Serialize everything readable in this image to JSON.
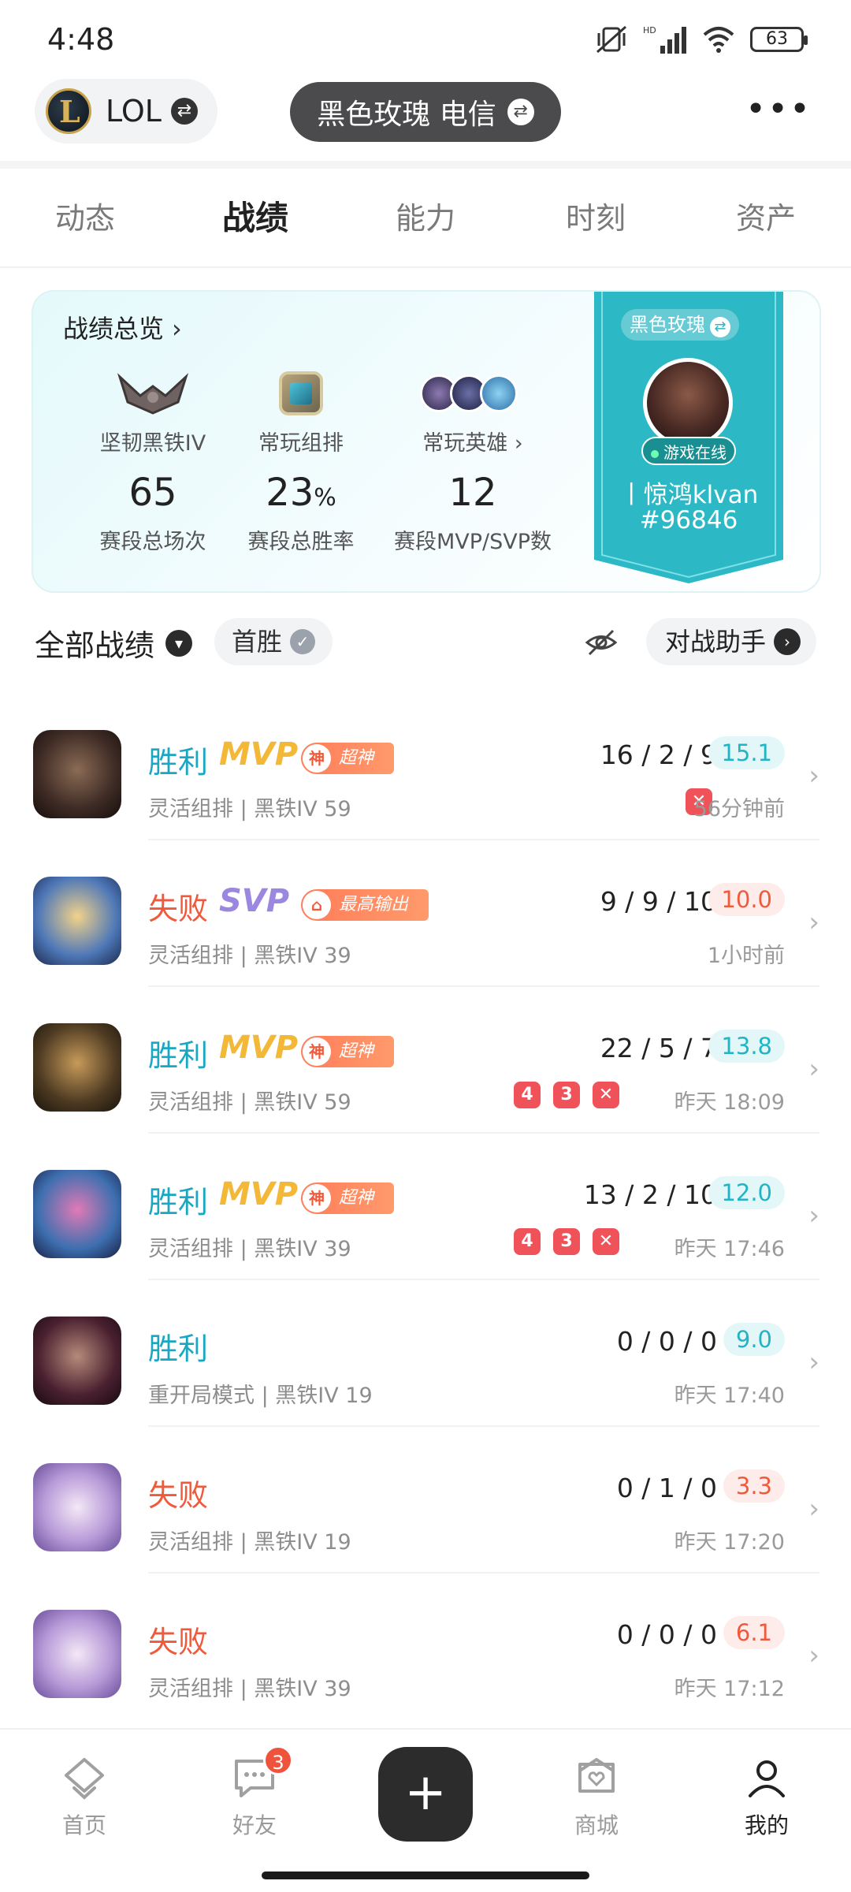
{
  "status_bar": {
    "time": "4:48",
    "battery": "63",
    "signal_label": "HD"
  },
  "header": {
    "game_name": "LOL",
    "game_logo_letter": "L",
    "account_label": "黑色玫瑰 电信",
    "swap_glyph": "⇄",
    "more_glyph": "•••"
  },
  "tabs": [
    {
      "label": "动态",
      "active": false
    },
    {
      "label": "战绩",
      "active": true
    },
    {
      "label": "能力",
      "active": false
    },
    {
      "label": "时刻",
      "active": false
    },
    {
      "label": "资产",
      "active": false
    }
  ],
  "overview": {
    "title": "战绩总览",
    "chevron": "›",
    "rank": {
      "label": "坚韧黑铁IV",
      "value": "65",
      "sub": "赛段总场次"
    },
    "mode": {
      "label": "常玩组排",
      "value": "23",
      "unit": "%",
      "sub": "赛段总胜率"
    },
    "heroes": {
      "label": "常玩英雄 ›",
      "value": "12",
      "sub": "赛段MVP/SVP数"
    },
    "profile": {
      "server": "黑色玫瑰",
      "online_status": "游戏在线",
      "nickname": "丨惊鸿klvan",
      "tag": "#96846"
    }
  },
  "filter": {
    "all_records": "全部战绩",
    "first_win": "首胜",
    "assistant": "对战助手",
    "dropdown_glyph": "▾",
    "check_glyph": "✓",
    "arrow_glyph": "›"
  },
  "matches": [
    {
      "result": "胜利",
      "outcome": "win",
      "badge": "MVP",
      "tag": "超神",
      "tag_icon": "神",
      "meta": "灵活组排 | 黑铁IV 59",
      "kda": "16 / 2 / 9",
      "score": "15.1",
      "score_level": "good",
      "when": "56分钟前",
      "mini": [
        "✕"
      ]
    },
    {
      "result": "失败",
      "outcome": "loss",
      "badge": "SVP",
      "tag": "最高输出",
      "tag_icon": "⌂",
      "meta": "灵活组排 | 黑铁IV 39",
      "kda": "9 / 9 / 10",
      "score": "10.0",
      "score_level": "bad",
      "when": "1小时前",
      "mini": []
    },
    {
      "result": "胜利",
      "outcome": "win",
      "badge": "MVP",
      "tag": "超神",
      "tag_icon": "神",
      "meta": "灵活组排 | 黑铁IV 59",
      "kda": "22 / 5 / 7",
      "score": "13.8",
      "score_level": "good",
      "when": "昨天 18:09",
      "mini": [
        "4",
        "3",
        "✕"
      ]
    },
    {
      "result": "胜利",
      "outcome": "win",
      "badge": "MVP",
      "tag": "超神",
      "tag_icon": "神",
      "meta": "灵活组排 | 黑铁IV 39",
      "kda": "13 / 2 / 10",
      "score": "12.0",
      "score_level": "good",
      "when": "昨天 17:46",
      "mini": [
        "4",
        "3",
        "✕"
      ]
    },
    {
      "result": "胜利",
      "outcome": "win",
      "badge": "",
      "tag": "",
      "tag_icon": "",
      "meta": "重开局模式 | 黑铁IV 19",
      "kda": "0 / 0 / 0",
      "score": "9.0",
      "score_level": "good",
      "when": "昨天 17:40",
      "mini": []
    },
    {
      "result": "失败",
      "outcome": "loss",
      "badge": "",
      "tag": "",
      "tag_icon": "",
      "meta": "灵活组排 | 黑铁IV 19",
      "kda": "0 / 1 / 0",
      "score": "3.3",
      "score_level": "bad",
      "when": "昨天 17:20",
      "mini": []
    },
    {
      "result": "失败",
      "outcome": "loss",
      "badge": "",
      "tag": "",
      "tag_icon": "",
      "meta": "灵活组排 | 黑铁IV 39",
      "kda": "0 / 0 / 0",
      "score": "6.1",
      "score_level": "bad",
      "when": "昨天 17:12",
      "mini": []
    }
  ],
  "bottom_nav": {
    "home": "首页",
    "friends": "好友",
    "friends_badge": "3",
    "add": "+",
    "store": "商城",
    "me": "我的"
  },
  "colors": {
    "win": "#1aa7c2",
    "loss": "#ef5a3c",
    "mvp": "#f3b838",
    "svp": "#9b86e0",
    "ribbon": "#2cb8c4"
  }
}
